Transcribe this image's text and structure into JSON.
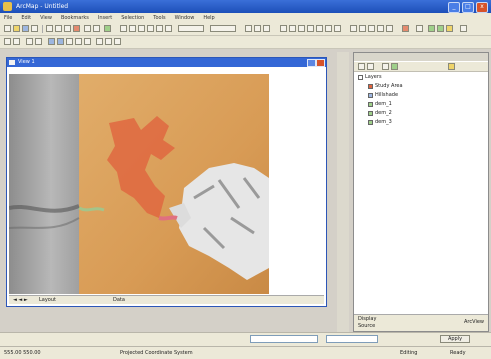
{
  "window": {
    "title": "ArcMap - Untitled"
  },
  "menu": [
    "File",
    "Edit",
    "View",
    "Bookmarks",
    "Insert",
    "Selection",
    "Tools",
    "Window",
    "Help"
  ],
  "map_window": {
    "title": "View 1",
    "tabs": [
      "Layout",
      "Data"
    ]
  },
  "toc": {
    "items": [
      {
        "label": "Layers",
        "icon": "layers-icon"
      },
      {
        "label": "Study Area",
        "icon": "polygon-layer-icon"
      },
      {
        "label": "Hillshade",
        "icon": "raster-layer-icon"
      },
      {
        "label": "dem_1",
        "icon": "raster-layer-icon"
      },
      {
        "label": "dem_2",
        "icon": "raster-layer-icon"
      },
      {
        "label": "dem_3",
        "icon": "raster-layer-icon"
      }
    ],
    "footer_left": "Display",
    "footer_left2": "Source",
    "footer_right": "ArcView"
  },
  "bottom": {
    "field1": "",
    "field2": "",
    "button": "Apply"
  },
  "status": {
    "left": "555.00  550.00",
    "mid": "Projected Coordinate System",
    "right1": "Editing",
    "right2": "Ready"
  },
  "colors": {
    "titlebar": "#1d4fb8",
    "terrain": "#d9a15a",
    "highlight": "#e0643f"
  }
}
